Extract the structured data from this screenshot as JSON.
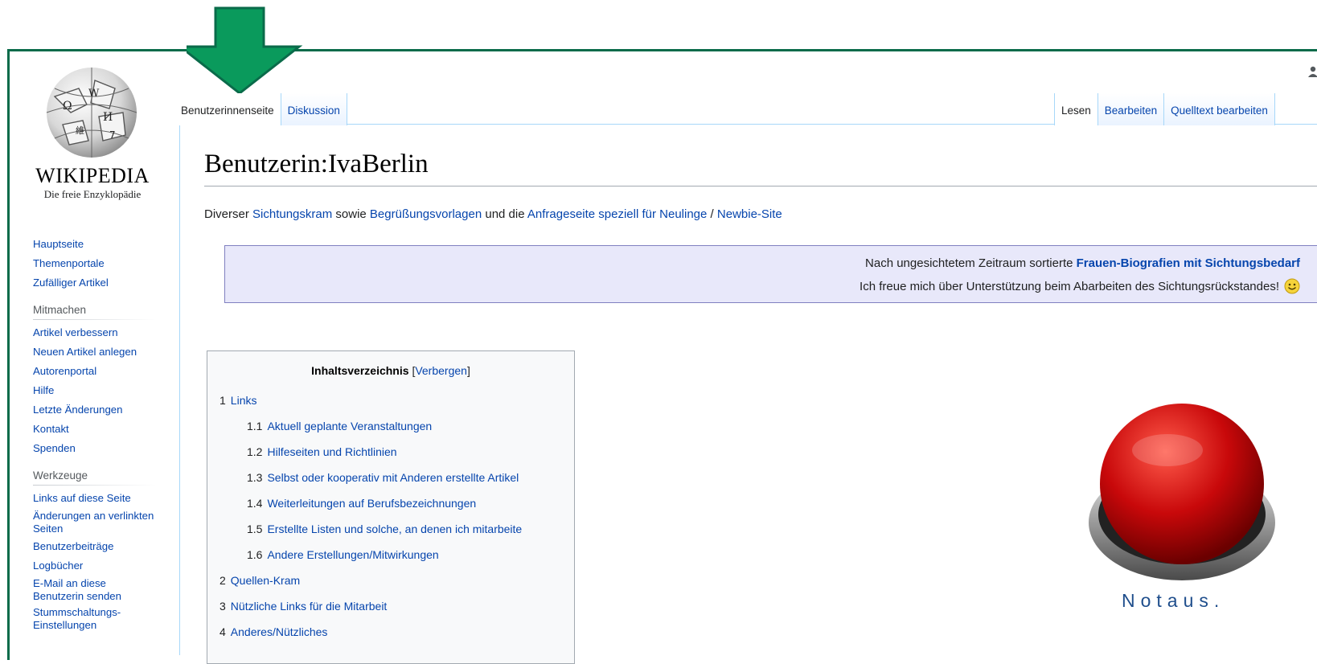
{
  "site": {
    "wordmark": "WIKIPEDIA",
    "tagline": "Die freie Enzyklopädie"
  },
  "sidebar": {
    "navigation": [
      "Hauptseite",
      "Themenportale",
      "Zufälliger Artikel"
    ],
    "mitmachen_heading": "Mitmachen",
    "mitmachen": [
      "Artikel verbessern",
      "Neuen Artikel anlegen",
      "Autorenportal",
      "Hilfe",
      "Letzte Änderungen",
      "Kontakt",
      "Spenden"
    ],
    "werkzeuge_heading": "Werkzeuge",
    "werkzeuge": [
      "Links auf diese Seite",
      "Änderungen an verlinkten Seiten",
      "Benutzerbeiträge",
      "Logbücher",
      "E-Mail an diese Benutzerin senden",
      "Stummschaltungs-Einstellungen"
    ]
  },
  "tabs": {
    "left": [
      "Benutzerinnenseite",
      "Diskussion"
    ],
    "right": [
      "Lesen",
      "Bearbeiten",
      "Quelltext bearbeiten"
    ]
  },
  "page": {
    "title": "Benutzerin:IvaBerlin",
    "intro": {
      "t1": "Diverser ",
      "l1": "Sichtungskram",
      "t2": " sowie ",
      "l2": "Begrüßungsvorlagen",
      "t3": " und die ",
      "l3": "Anfrageseite speziell für Neulinge",
      "t4": " / ",
      "l4": "Newbie-Site"
    },
    "banner": {
      "line1_text": "Nach ungesichtetem Zeitraum sortierte ",
      "line1_link": "Frauen-Biografien mit Sichtungsbedarf",
      "line2": "Ich freue mich über Unterstützung beim Abarbeiten des Sichtungsrückstandes!"
    }
  },
  "toc": {
    "title": "Inhaltsverzeichnis",
    "toggle_open": "[",
    "toggle": "Verbergen",
    "toggle_close": "]",
    "items": [
      {
        "num": "1",
        "label": "Links"
      },
      {
        "num": "1.1",
        "label": "Aktuell geplante Veranstaltungen"
      },
      {
        "num": "1.2",
        "label": "Hilfeseiten und Richtlinien"
      },
      {
        "num": "1.3",
        "label": "Selbst oder kooperativ mit Anderen erstellte Artikel"
      },
      {
        "num": "1.4",
        "label": "Weiterleitungen auf Berufsbezeichnungen"
      },
      {
        "num": "1.5",
        "label": "Erstellte Listen und solche, an denen ich mitarbeite"
      },
      {
        "num": "1.6",
        "label": "Andere Erstellungen/Mitwirkungen"
      },
      {
        "num": "2",
        "label": "Quellen-Kram"
      },
      {
        "num": "3",
        "label": "Nützliche Links für die Mitarbeit"
      },
      {
        "num": "4",
        "label": "Anderes/Nützliches"
      }
    ]
  },
  "notaus": {
    "label": "Notaus."
  },
  "colors": {
    "link": "#0645ad",
    "frame": "#0a6b4a",
    "arrow": "#0a9a5c",
    "banner_bg": "#e8e8fa",
    "button_red": "#d01010"
  }
}
